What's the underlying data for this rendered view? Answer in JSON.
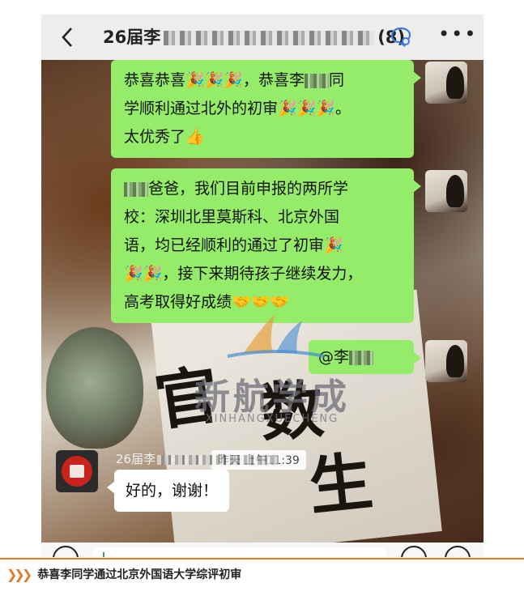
{
  "header": {
    "title_prefix": "26届李",
    "title_suffix": "(8)",
    "back_icon": "chevron-left-icon",
    "more_icon": "more-dots-icon"
  },
  "messages": [
    {
      "side": "right",
      "lines": [
        {
          "text": "恭喜恭喜🎉🎉🎉，恭喜李",
          "after_blur": "同"
        },
        {
          "text": "学顺利通过北外的初审🎉🎉🎉。"
        },
        {
          "text": "太优秀了👍"
        }
      ]
    },
    {
      "side": "right",
      "lines": [
        {
          "text": "",
          "after_blur": "爸爸，我们目前申报的两所学"
        },
        {
          "text": "校：深圳北里莫斯科、北京外国"
        },
        {
          "text": "语，均已经顺利的通过了初审🎉"
        },
        {
          "text": "🎉🎉，接下来期待孩子继续发力，"
        },
        {
          "text": "高考取得好成绩🤝🤝🤝"
        }
      ]
    },
    {
      "side": "right",
      "mention": "@李"
    }
  ],
  "timestamp": "昨天 上午11:39",
  "reply": {
    "sender_prefix": "26届李",
    "text": "好的，谢谢！"
  },
  "watermark": {
    "text": "新航学成",
    "sub": "XINHANGXUECHENG"
  },
  "calligraphy": [
    "官",
    "数",
    "生"
  ],
  "caption": "恭喜李同学通过北京外国语大学综评初审",
  "colors": {
    "bubble_green": "#95ec69",
    "accent_orange": "#e37a2a"
  }
}
